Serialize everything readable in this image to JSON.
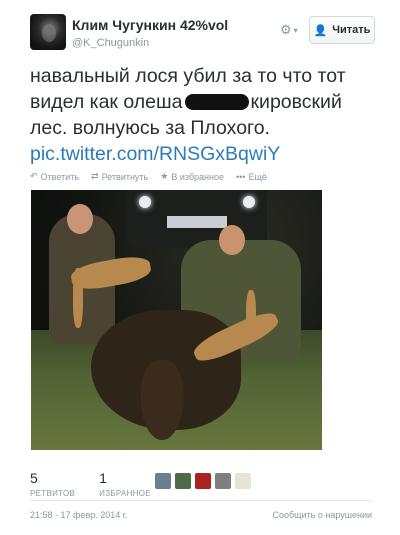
{
  "user": {
    "display_name": "Клим Чугункин 42%vol",
    "screen_name": "@K_Chugunkin"
  },
  "follow_button": {
    "label": "Читать"
  },
  "tweet": {
    "text_line1": "навальный лося убил за то что тот",
    "text_line2_before": "видел как олеша",
    "text_line2_after": "кировский",
    "text_line3": "лес. волнуюсь за Плохого.",
    "link": "pic.twitter.com/RNSGxBqwiY"
  },
  "actions": {
    "reply": "Ответить",
    "retweet": "Ретвитнуть",
    "favorite": "В избранное",
    "more": "Ещё"
  },
  "stats": {
    "retweets": "5",
    "retweets_label": "РЕТВИТОВ",
    "favorites": "1",
    "favorites_label": "ИЗБРАННОЕ"
  },
  "footer": {
    "timestamp": "21:58 - 17 февр. 2014 г.",
    "report": "Сообщить о нарушении"
  },
  "colors": {
    "link": "#2b7bb9",
    "muted": "#8899a6",
    "text": "#292f33"
  }
}
